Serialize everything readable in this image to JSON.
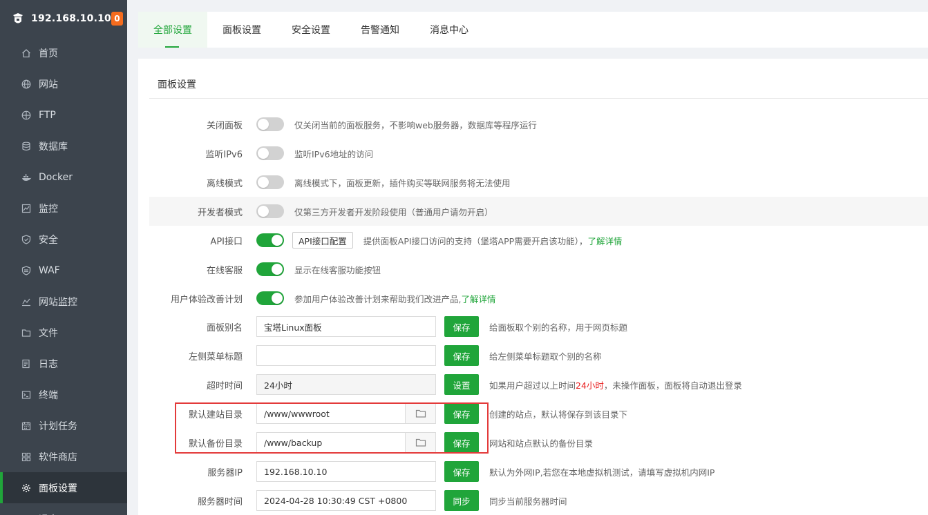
{
  "sidebar": {
    "server_ip": "192.168.10.10",
    "badge": "0",
    "items": [
      {
        "label": "首页",
        "icon": "home-icon"
      },
      {
        "label": "网站",
        "icon": "globe-icon"
      },
      {
        "label": "FTP",
        "icon": "ftp-globe-icon"
      },
      {
        "label": "数据库",
        "icon": "database-icon"
      },
      {
        "label": "Docker",
        "icon": "docker-icon"
      },
      {
        "label": "监控",
        "icon": "monitor-icon"
      },
      {
        "label": "安全",
        "icon": "shield-icon"
      },
      {
        "label": "WAF",
        "icon": "waf-shield-icon"
      },
      {
        "label": "网站监控",
        "icon": "chart-icon"
      },
      {
        "label": "文件",
        "icon": "folder-icon"
      },
      {
        "label": "日志",
        "icon": "log-icon"
      },
      {
        "label": "终端",
        "icon": "terminal-icon"
      },
      {
        "label": "计划任务",
        "icon": "calendar-icon"
      },
      {
        "label": "软件商店",
        "icon": "apps-icon"
      },
      {
        "label": "面板设置",
        "icon": "gear-icon",
        "active": true
      },
      {
        "label": "退出",
        "icon": "logout-icon"
      }
    ]
  },
  "tabs": [
    "全部设置",
    "面板设置",
    "安全设置",
    "告警通知",
    "消息中心"
  ],
  "panel": {
    "title": "面板设置",
    "rows": {
      "close_panel": {
        "label": "关闭面板",
        "desc": "仅关闭当前的面板服务，不影响web服务器，数据库等程序运行",
        "on": false
      },
      "ipv6": {
        "label": "监听IPv6",
        "desc": "监听IPv6地址的访问",
        "on": false
      },
      "offline": {
        "label": "离线模式",
        "desc": "离线模式下，面板更新，插件购买等联网服务将无法使用",
        "on": false
      },
      "developer": {
        "label": "开发者模式",
        "desc": "仅第三方开发者开发阶段使用（普通用户请勿开启）",
        "on": false
      },
      "api": {
        "label": "API接口",
        "button": "API接口配置",
        "desc": "提供面板API接口访问的支持（堡塔APP需要开启该功能），",
        "link": "了解详情",
        "on": true
      },
      "support": {
        "label": "在线客服",
        "desc": "显示在线客服功能按钮",
        "on": true
      },
      "ux": {
        "label": "用户体验改善计划",
        "desc": "参加用户体验改善计划来帮助我们改进产品,",
        "link": "了解详情",
        "on": true
      },
      "alias": {
        "label": "面板别名",
        "value": "宝塔Linux面板",
        "button": "保存",
        "desc": "给面板取个别的名称，用于网页标题"
      },
      "menu_title": {
        "label": "左侧菜单标题",
        "value": "",
        "button": "保存",
        "desc": "给左侧菜单标题取个别的名称"
      },
      "timeout": {
        "label": "超时时间",
        "value": "24小时",
        "button": "设置",
        "desc_pre": "如果用户超过以上时间",
        "desc_red": "24小时",
        "desc_post": "，未操作面板，面板将自动退出登录"
      },
      "site_dir": {
        "label": "默认建站目录",
        "value": "/www/wwwroot",
        "button": "保存",
        "desc": "创建的站点，默认将保存到该目录下"
      },
      "backup_dir": {
        "label": "默认备份目录",
        "value": "/www/backup",
        "button": "保存",
        "desc": "网站和站点默认的备份目录"
      },
      "server_ip": {
        "label": "服务器IP",
        "value": "192.168.10.10",
        "button": "保存",
        "desc": "默认为外网IP,若您在本地虚拟机测试，请填写虚拟机内网IP"
      },
      "server_time": {
        "label": "服务器时间",
        "value": "2024-04-28 10:30:49 CST +0800",
        "button": "同步",
        "desc": "同步当前服务器时间"
      }
    }
  }
}
